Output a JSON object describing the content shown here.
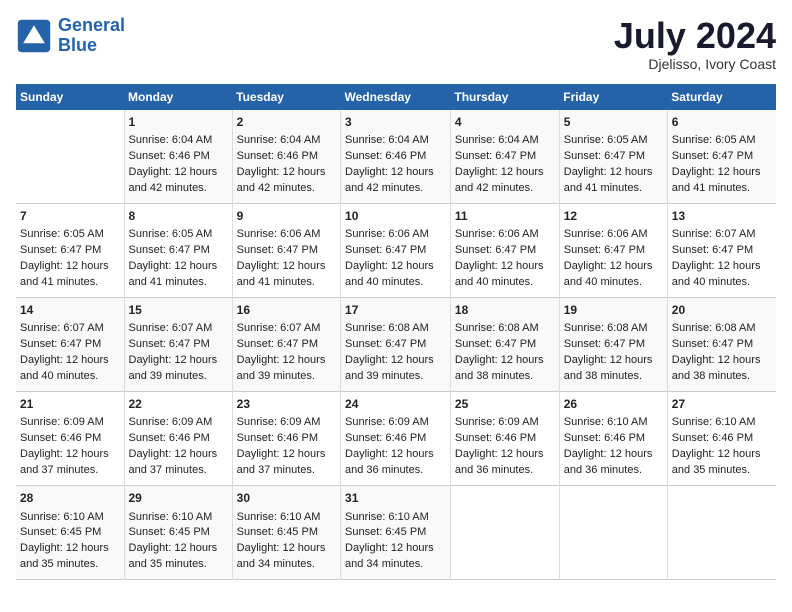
{
  "logo": {
    "line1": "General",
    "line2": "Blue"
  },
  "title": "July 2024",
  "location": "Djelisso, Ivory Coast",
  "days_header": [
    "Sunday",
    "Monday",
    "Tuesday",
    "Wednesday",
    "Thursday",
    "Friday",
    "Saturday"
  ],
  "weeks": [
    [
      {
        "day": "",
        "sunrise": "",
        "sunset": "",
        "daylight": ""
      },
      {
        "day": "1",
        "sunrise": "Sunrise: 6:04 AM",
        "sunset": "Sunset: 6:46 PM",
        "daylight": "Daylight: 12 hours and 42 minutes."
      },
      {
        "day": "2",
        "sunrise": "Sunrise: 6:04 AM",
        "sunset": "Sunset: 6:46 PM",
        "daylight": "Daylight: 12 hours and 42 minutes."
      },
      {
        "day": "3",
        "sunrise": "Sunrise: 6:04 AM",
        "sunset": "Sunset: 6:46 PM",
        "daylight": "Daylight: 12 hours and 42 minutes."
      },
      {
        "day": "4",
        "sunrise": "Sunrise: 6:04 AM",
        "sunset": "Sunset: 6:47 PM",
        "daylight": "Daylight: 12 hours and 42 minutes."
      },
      {
        "day": "5",
        "sunrise": "Sunrise: 6:05 AM",
        "sunset": "Sunset: 6:47 PM",
        "daylight": "Daylight: 12 hours and 41 minutes."
      },
      {
        "day": "6",
        "sunrise": "Sunrise: 6:05 AM",
        "sunset": "Sunset: 6:47 PM",
        "daylight": "Daylight: 12 hours and 41 minutes."
      }
    ],
    [
      {
        "day": "7",
        "sunrise": "Sunrise: 6:05 AM",
        "sunset": "Sunset: 6:47 PM",
        "daylight": "Daylight: 12 hours and 41 minutes."
      },
      {
        "day": "8",
        "sunrise": "Sunrise: 6:05 AM",
        "sunset": "Sunset: 6:47 PM",
        "daylight": "Daylight: 12 hours and 41 minutes."
      },
      {
        "day": "9",
        "sunrise": "Sunrise: 6:06 AM",
        "sunset": "Sunset: 6:47 PM",
        "daylight": "Daylight: 12 hours and 41 minutes."
      },
      {
        "day": "10",
        "sunrise": "Sunrise: 6:06 AM",
        "sunset": "Sunset: 6:47 PM",
        "daylight": "Daylight: 12 hours and 40 minutes."
      },
      {
        "day": "11",
        "sunrise": "Sunrise: 6:06 AM",
        "sunset": "Sunset: 6:47 PM",
        "daylight": "Daylight: 12 hours and 40 minutes."
      },
      {
        "day": "12",
        "sunrise": "Sunrise: 6:06 AM",
        "sunset": "Sunset: 6:47 PM",
        "daylight": "Daylight: 12 hours and 40 minutes."
      },
      {
        "day": "13",
        "sunrise": "Sunrise: 6:07 AM",
        "sunset": "Sunset: 6:47 PM",
        "daylight": "Daylight: 12 hours and 40 minutes."
      }
    ],
    [
      {
        "day": "14",
        "sunrise": "Sunrise: 6:07 AM",
        "sunset": "Sunset: 6:47 PM",
        "daylight": "Daylight: 12 hours and 40 minutes."
      },
      {
        "day": "15",
        "sunrise": "Sunrise: 6:07 AM",
        "sunset": "Sunset: 6:47 PM",
        "daylight": "Daylight: 12 hours and 39 minutes."
      },
      {
        "day": "16",
        "sunrise": "Sunrise: 6:07 AM",
        "sunset": "Sunset: 6:47 PM",
        "daylight": "Daylight: 12 hours and 39 minutes."
      },
      {
        "day": "17",
        "sunrise": "Sunrise: 6:08 AM",
        "sunset": "Sunset: 6:47 PM",
        "daylight": "Daylight: 12 hours and 39 minutes."
      },
      {
        "day": "18",
        "sunrise": "Sunrise: 6:08 AM",
        "sunset": "Sunset: 6:47 PM",
        "daylight": "Daylight: 12 hours and 38 minutes."
      },
      {
        "day": "19",
        "sunrise": "Sunrise: 6:08 AM",
        "sunset": "Sunset: 6:47 PM",
        "daylight": "Daylight: 12 hours and 38 minutes."
      },
      {
        "day": "20",
        "sunrise": "Sunrise: 6:08 AM",
        "sunset": "Sunset: 6:47 PM",
        "daylight": "Daylight: 12 hours and 38 minutes."
      }
    ],
    [
      {
        "day": "21",
        "sunrise": "Sunrise: 6:09 AM",
        "sunset": "Sunset: 6:46 PM",
        "daylight": "Daylight: 12 hours and 37 minutes."
      },
      {
        "day": "22",
        "sunrise": "Sunrise: 6:09 AM",
        "sunset": "Sunset: 6:46 PM",
        "daylight": "Daylight: 12 hours and 37 minutes."
      },
      {
        "day": "23",
        "sunrise": "Sunrise: 6:09 AM",
        "sunset": "Sunset: 6:46 PM",
        "daylight": "Daylight: 12 hours and 37 minutes."
      },
      {
        "day": "24",
        "sunrise": "Sunrise: 6:09 AM",
        "sunset": "Sunset: 6:46 PM",
        "daylight": "Daylight: 12 hours and 36 minutes."
      },
      {
        "day": "25",
        "sunrise": "Sunrise: 6:09 AM",
        "sunset": "Sunset: 6:46 PM",
        "daylight": "Daylight: 12 hours and 36 minutes."
      },
      {
        "day": "26",
        "sunrise": "Sunrise: 6:10 AM",
        "sunset": "Sunset: 6:46 PM",
        "daylight": "Daylight: 12 hours and 36 minutes."
      },
      {
        "day": "27",
        "sunrise": "Sunrise: 6:10 AM",
        "sunset": "Sunset: 6:46 PM",
        "daylight": "Daylight: 12 hours and 35 minutes."
      }
    ],
    [
      {
        "day": "28",
        "sunrise": "Sunrise: 6:10 AM",
        "sunset": "Sunset: 6:45 PM",
        "daylight": "Daylight: 12 hours and 35 minutes."
      },
      {
        "day": "29",
        "sunrise": "Sunrise: 6:10 AM",
        "sunset": "Sunset: 6:45 PM",
        "daylight": "Daylight: 12 hours and 35 minutes."
      },
      {
        "day": "30",
        "sunrise": "Sunrise: 6:10 AM",
        "sunset": "Sunset: 6:45 PM",
        "daylight": "Daylight: 12 hours and 34 minutes."
      },
      {
        "day": "31",
        "sunrise": "Sunrise: 6:10 AM",
        "sunset": "Sunset: 6:45 PM",
        "daylight": "Daylight: 12 hours and 34 minutes."
      },
      {
        "day": "",
        "sunrise": "",
        "sunset": "",
        "daylight": ""
      },
      {
        "day": "",
        "sunrise": "",
        "sunset": "",
        "daylight": ""
      },
      {
        "day": "",
        "sunrise": "",
        "sunset": "",
        "daylight": ""
      }
    ]
  ]
}
